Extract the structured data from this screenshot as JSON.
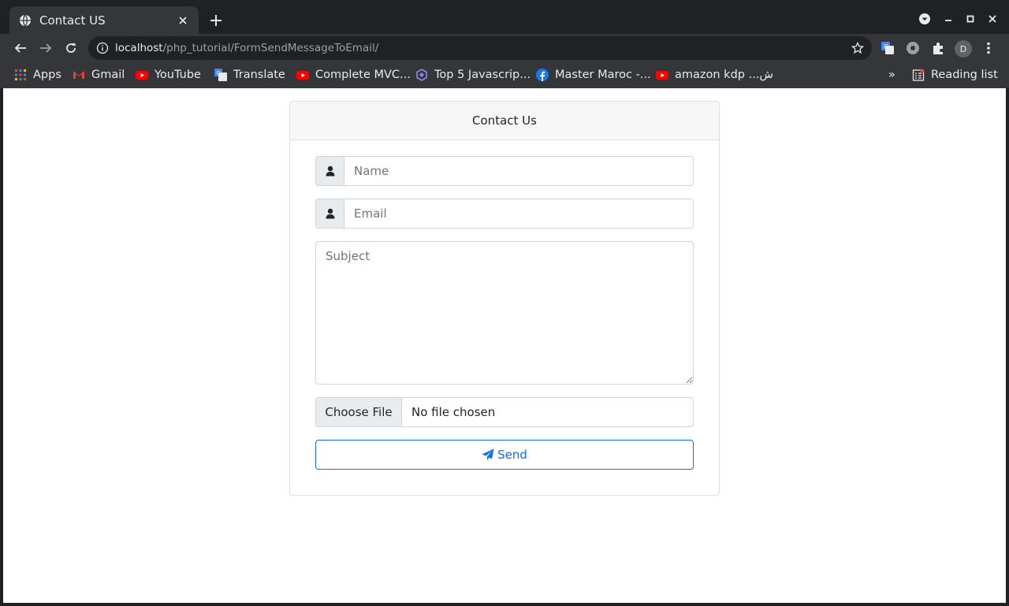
{
  "browser": {
    "tab": {
      "title": "Contact US",
      "favicon": "globe-icon"
    },
    "address": {
      "host": "localhost",
      "path": "/php_tutorial/FormSendMessageToEmail/"
    },
    "profile_initial": "D",
    "bookmarks": [
      {
        "label": "Apps",
        "icon": "apps-grid-icon"
      },
      {
        "label": "Gmail",
        "icon": "gmail-icon"
      },
      {
        "label": "YouTube",
        "icon": "youtube-icon"
      },
      {
        "label": "Translate",
        "icon": "translate-icon"
      },
      {
        "label": "Complete MVC...",
        "icon": "youtube-icon"
      },
      {
        "label": "Top 5 Javascrip...",
        "icon": "extension-icon"
      },
      {
        "label": "Master Maroc -...",
        "icon": "facebook-icon"
      },
      {
        "label": "amazon kdp ...ش",
        "icon": "youtube-icon"
      }
    ],
    "more_bookmarks": "»",
    "reading_list": "Reading list"
  },
  "form": {
    "header": "Contact Us",
    "name_placeholder": "Name",
    "email_placeholder": "Email",
    "subject_placeholder": "Subject",
    "file_button": "Choose File",
    "file_status": "No file chosen",
    "send_label": "Send"
  },
  "colors": {
    "accent": "#0d6efd",
    "chrome_dark": "#202124",
    "chrome_toolbar": "#35363a"
  }
}
